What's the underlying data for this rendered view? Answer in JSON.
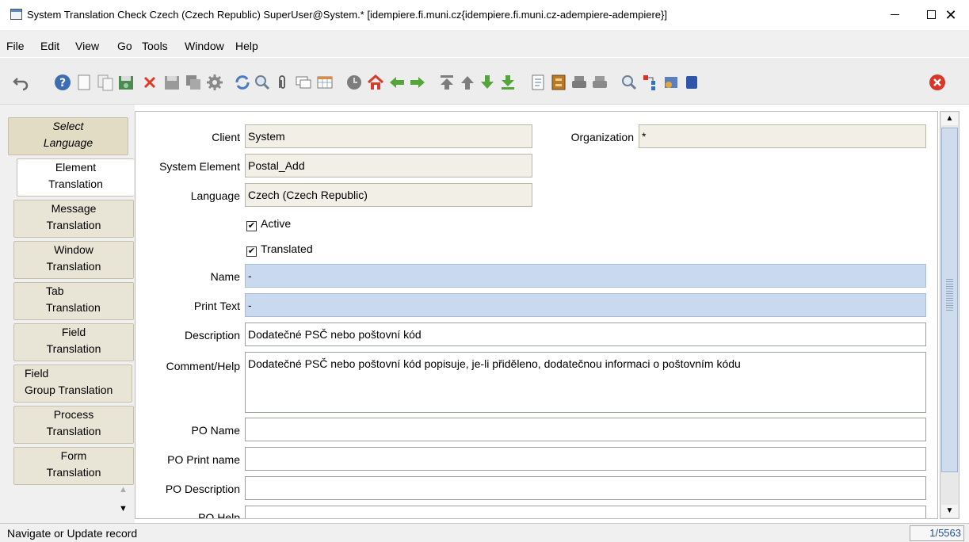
{
  "window": {
    "title": "System Translation Check  Czech (Czech Republic)  SuperUser@System.* [idempiere.fi.muni.cz{idempiere.fi.muni.cz-adempiere-adempiere}]",
    "minimize": "—",
    "maximize": "",
    "close": "✕"
  },
  "menu": {
    "file": "File",
    "edit": "Edit",
    "view": "View",
    "go": "Go",
    "tools": "Tools",
    "window": "Window",
    "help": "Help"
  },
  "toolbar": {
    "icons": [
      "undo-icon",
      "help-icon",
      "new-record-icon",
      "copy-record-icon",
      "save-new-icon",
      "delete-icon",
      "save-icon",
      "multi-record-icon",
      "settings-icon",
      "refresh-icon",
      "find-icon",
      "attachment-icon",
      "chat-icon",
      "grid-toggle-icon",
      "history-icon",
      "home-icon",
      "parent-icon",
      "detail-icon",
      "first-record-icon",
      "previous-record-icon",
      "next-record-icon",
      "last-record-icon",
      "report-icon",
      "archive-icon",
      "print-preview-icon",
      "print-icon",
      "zoom-across-icon",
      "workflow-icon",
      "product-info-icon",
      "end-icon",
      "close-window-icon"
    ]
  },
  "tabs": [
    {
      "line1": "Select",
      "line2": "Language"
    },
    {
      "line1": "Element",
      "line2": "Translation"
    },
    {
      "line1": "Message",
      "line2": "Translation"
    },
    {
      "line1": "Window",
      "line2": "Translation"
    },
    {
      "line1": "Tab",
      "line2": "Translation"
    },
    {
      "line1": "Field",
      "line2": "Translation"
    },
    {
      "line1": "Field",
      "line2": "Group Translation"
    },
    {
      "line1": "Process",
      "line2": "Translation"
    },
    {
      "line1": "Form",
      "line2": "Translation"
    }
  ],
  "form": {
    "client_label": "Client",
    "client_value": "System",
    "org_label": "Organization",
    "org_value": "*",
    "element_label": "System Element",
    "element_value": "Postal_Add",
    "language_label": "Language",
    "language_value": "Czech (Czech Republic)",
    "active_label": "Active",
    "active_checked": "✔",
    "translated_label": "Translated",
    "translated_checked": "✔",
    "name_label": "Name",
    "name_value": "-",
    "print_text_label": "Print Text",
    "print_text_value": "-",
    "description_label": "Description",
    "description_value": "Dodatečné PSČ nebo poštovní kód",
    "comment_label": "Comment/Help",
    "comment_value": "Dodatečné PSČ nebo poštovní kód popisuje, je-li přiděleno, dodatečnou informaci o poštovním kódu",
    "po_name_label": "PO Name",
    "po_name_value": "",
    "po_print_label": "PO Print name",
    "po_print_value": "",
    "po_desc_label": "PO Description",
    "po_desc_value": "",
    "po_help_label": "PO Help"
  },
  "status": {
    "message": "Navigate or Update record",
    "record_count": "1/5563"
  },
  "colors": {
    "mandatory_field": "#c9daf0",
    "readonly_field": "#f1efe6",
    "tab_background": "#e9e5d6",
    "record_count_text": "#1d4fa0"
  }
}
